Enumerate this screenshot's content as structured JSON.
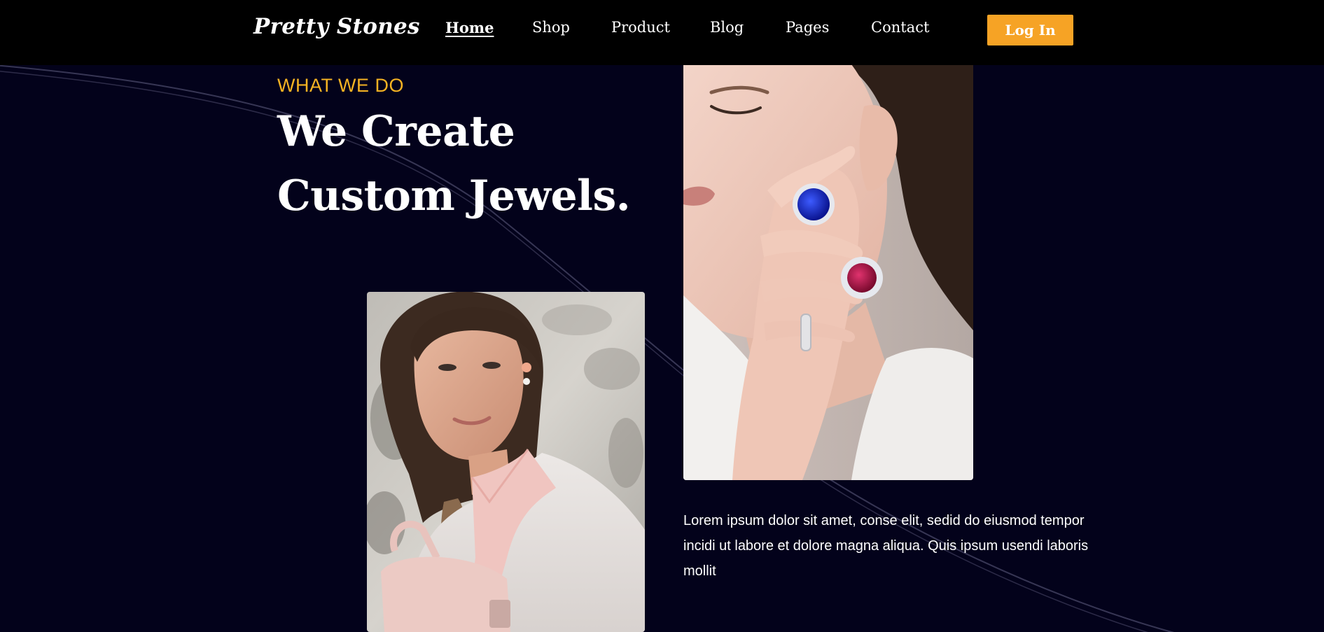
{
  "brand": {
    "logo_text": "Pretty Stones"
  },
  "nav": {
    "items": [
      {
        "label": "Home",
        "active": true
      },
      {
        "label": "Shop",
        "active": false
      },
      {
        "label": "Product",
        "active": false
      },
      {
        "label": "Blog",
        "active": false
      },
      {
        "label": "Pages",
        "active": false
      },
      {
        "label": "Contact",
        "active": false
      }
    ],
    "login_label": "Log In"
  },
  "hero": {
    "eyebrow": "WHAT WE DO",
    "headline": "We Create Custom Jewels.",
    "body": "Lorem ipsum dolor sit amet, conse elit, sedid do eiusmod tempor incidi ut labore et dolore magna aliqua. Quis ipsum usendi laboris mollit"
  },
  "images": {
    "left": "woman-with-pink-backpack-photo",
    "right": "woman-wearing-gemstone-rings-photo"
  },
  "colors": {
    "background": "#03021b",
    "header": "#000000",
    "accent": "#f6a325",
    "eyebrow": "#f6b323",
    "text": "#ffffff"
  }
}
